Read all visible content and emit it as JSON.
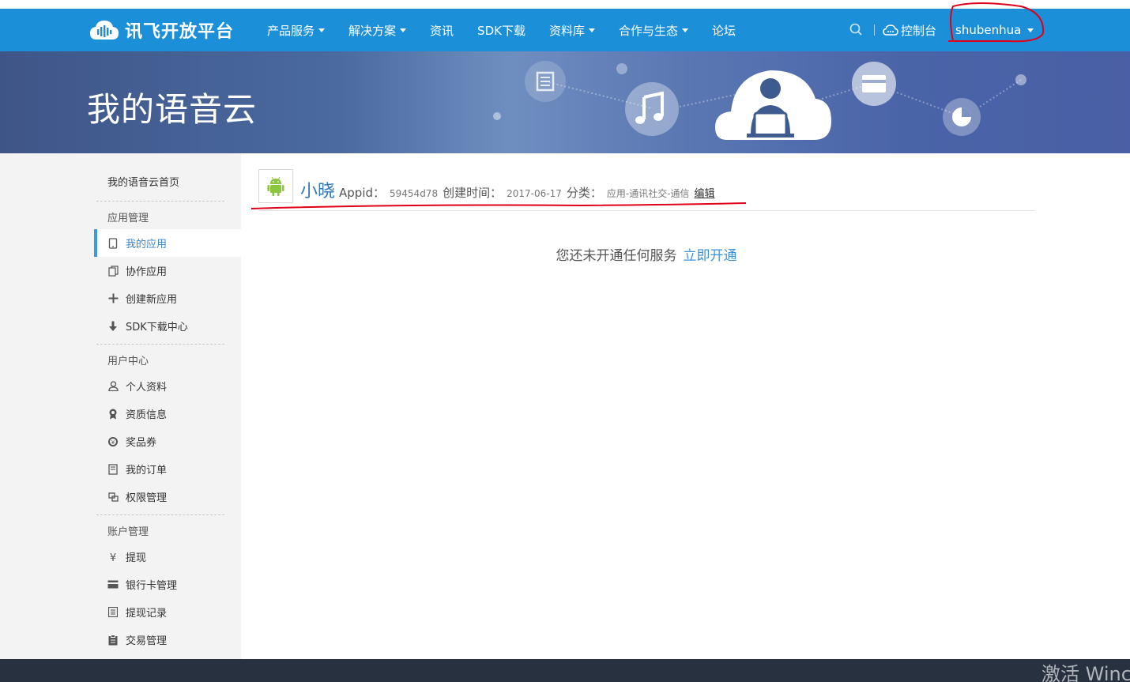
{
  "nav": {
    "logo_text": "讯飞开放平台",
    "items": [
      {
        "label": "产品服务",
        "dropdown": true
      },
      {
        "label": "解决方案",
        "dropdown": true
      },
      {
        "label": "资讯",
        "dropdown": false
      },
      {
        "label": "SDK下载",
        "dropdown": false
      },
      {
        "label": "资料库",
        "dropdown": true
      },
      {
        "label": "合作与生态",
        "dropdown": true
      },
      {
        "label": "论坛",
        "dropdown": false
      }
    ],
    "console_label": "控制台",
    "username": "shubenhua"
  },
  "banner": {
    "title": "我的语音云"
  },
  "sidebar": {
    "home": "我的语音云首页",
    "sections": [
      {
        "header": "应用管理",
        "items": [
          {
            "label": "我的应用",
            "icon": "phone-icon",
            "active": true
          },
          {
            "label": "协作应用",
            "icon": "copy-icon",
            "active": false
          },
          {
            "label": "创建新应用",
            "icon": "plus-icon",
            "active": false
          },
          {
            "label": "SDK下载中心",
            "icon": "download-icon",
            "active": false
          }
        ]
      },
      {
        "header": "用户中心",
        "items": [
          {
            "label": "个人资料",
            "icon": "user-icon",
            "active": false
          },
          {
            "label": "资质信息",
            "icon": "award-icon",
            "active": false
          },
          {
            "label": "奖品券",
            "icon": "coupon-icon",
            "active": false
          },
          {
            "label": "我的订单",
            "icon": "order-icon",
            "active": false
          },
          {
            "label": "权限管理",
            "icon": "permission-icon",
            "active": false
          }
        ]
      },
      {
        "header": "账户管理",
        "items": [
          {
            "label": "提现",
            "icon": "yen-icon",
            "active": false
          },
          {
            "label": "银行卡管理",
            "icon": "card-icon",
            "active": false
          },
          {
            "label": "提现记录",
            "icon": "list-icon",
            "active": false
          },
          {
            "label": "交易管理",
            "icon": "clipboard-icon",
            "active": false
          }
        ]
      }
    ]
  },
  "app": {
    "name": "小晓",
    "appid_label": "Appid：",
    "appid": "59454d78",
    "created_label": "创建时间：",
    "created": "2017-06-17",
    "category_label": "分类：",
    "category": "应用-通讯社交-通信",
    "edit_label": "编辑",
    "platform_icon": "android-icon"
  },
  "empty_state": {
    "message": "您还未开通任何服务",
    "action": "立即开通"
  },
  "watermark": "激活 Winc",
  "colors": {
    "nav_bg": "#1c8fd9",
    "active_accent": "#3d9ae0",
    "link": "#3d93d8",
    "annotation_red": "#e0001a",
    "android_green": "#8cc63f"
  }
}
